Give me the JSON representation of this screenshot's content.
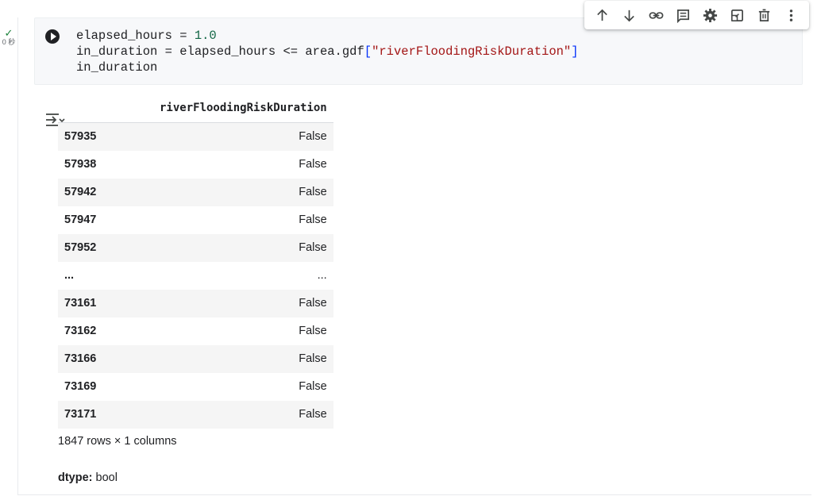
{
  "exec": {
    "check": "✓",
    "time": "0 秒"
  },
  "code": {
    "line1": {
      "a": "elapsed_hours = ",
      "num": "1.0"
    },
    "line2": {
      "a": "in_duration = elapsed_hours <= area.gdf",
      "ob": "[",
      "str": "\"riverFloodingRiskDuration\"",
      "cb": "]"
    },
    "line3": "in_duration"
  },
  "toolbar": {
    "items": [
      "arrow-up-icon",
      "arrow-down-icon",
      "link-icon",
      "comment-icon",
      "gear-icon",
      "mirror-cell-icon",
      "delete-icon",
      "more-vert-icon"
    ]
  },
  "output": {
    "column_header": "riverFloodingRiskDuration",
    "rows": [
      {
        "index": "57935",
        "value": "False"
      },
      {
        "index": "57938",
        "value": "False"
      },
      {
        "index": "57942",
        "value": "False"
      },
      {
        "index": "57947",
        "value": "False"
      },
      {
        "index": "57952",
        "value": "False"
      },
      {
        "index": "...",
        "value": "..."
      },
      {
        "index": "73161",
        "value": "False"
      },
      {
        "index": "73162",
        "value": "False"
      },
      {
        "index": "73166",
        "value": "False"
      },
      {
        "index": "73169",
        "value": "False"
      },
      {
        "index": "73171",
        "value": "False"
      }
    ],
    "shape": "1847 rows × 1 columns",
    "dtype_label": "dtype:",
    "dtype_value": " bool"
  }
}
